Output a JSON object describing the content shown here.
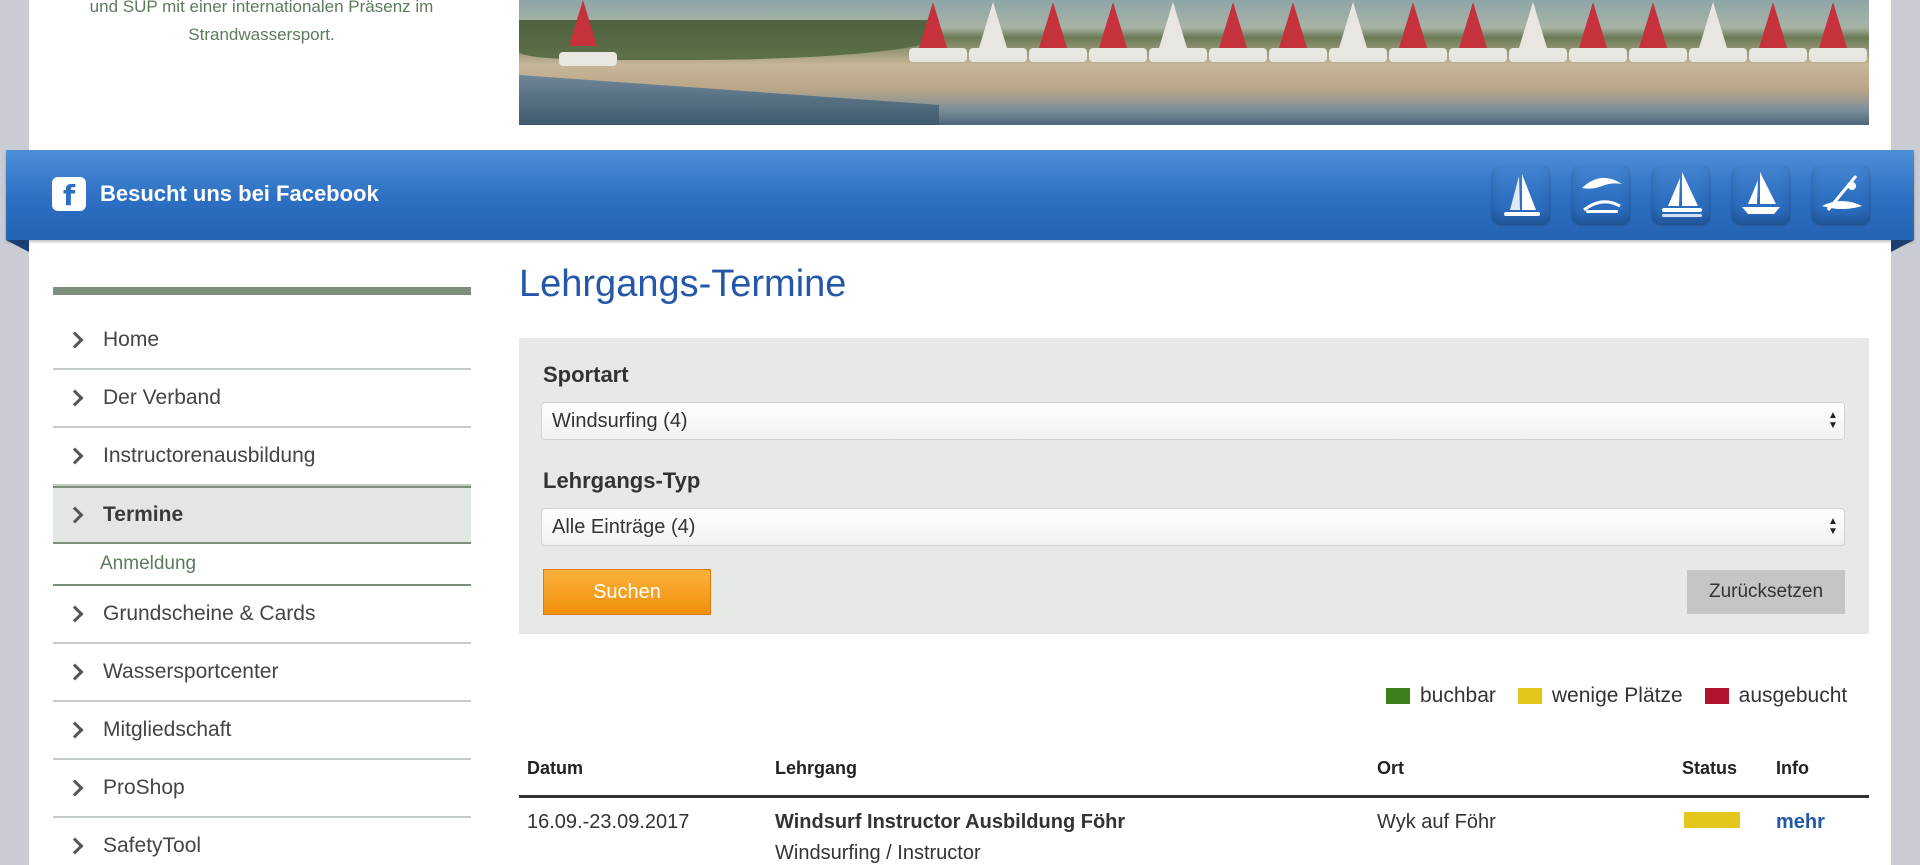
{
  "header": {
    "tagline_line1": "und SUP mit einer internationalen Präsenz im",
    "tagline_line2": "Strandwassersport."
  },
  "band": {
    "facebook_label": "Besucht uns bei Facebook",
    "icons": [
      "windsurfing-icon",
      "kitesurfing-icon",
      "catamaran-icon",
      "sailing-icon",
      "sup-icon"
    ],
    "icon_colors": [
      "#f2921d",
      "#a35bb0",
      "#1aa1dc",
      "#3aa99a",
      "#f6c21a"
    ]
  },
  "sidebar": {
    "items": [
      {
        "label": "Home"
      },
      {
        "label": "Der Verband"
      },
      {
        "label": "Instructorenausbildung"
      },
      {
        "label": "Termine"
      },
      {
        "label": "Grundscheine & Cards"
      },
      {
        "label": "Wassersportcenter"
      },
      {
        "label": "Mitgliedschaft"
      },
      {
        "label": "ProShop"
      },
      {
        "label": "SafetyTool"
      }
    ],
    "active": "Termine",
    "sub_item": "Anmeldung"
  },
  "main": {
    "title": "Lehrgangs-Termine",
    "filter": {
      "sport_label": "Sportart",
      "sport_value": "Windsurfing (4)",
      "type_label": "Lehrgangs-Typ",
      "type_value": "Alle Einträge (4)",
      "search_button": "Suchen",
      "reset_button": "Zurücksetzen"
    },
    "legend": [
      {
        "label": "buchbar",
        "color": "#3d7f1a"
      },
      {
        "label": "wenige Plätze",
        "color": "#e3c81b"
      },
      {
        "label": "ausgebucht",
        "color": "#b0142e"
      }
    ],
    "table": {
      "headers": [
        "Datum",
        "Lehrgang",
        "Ort",
        "Status",
        "Info"
      ],
      "rows": [
        {
          "date": "16.09.-23.09.2017",
          "course": "Windsurf Instructor Ausbildung Föhr",
          "course_sub": "Windsurfing / Instructor",
          "place": "Wyk auf Föhr",
          "status_color": "#e3c81b",
          "info": "mehr"
        }
      ]
    }
  }
}
